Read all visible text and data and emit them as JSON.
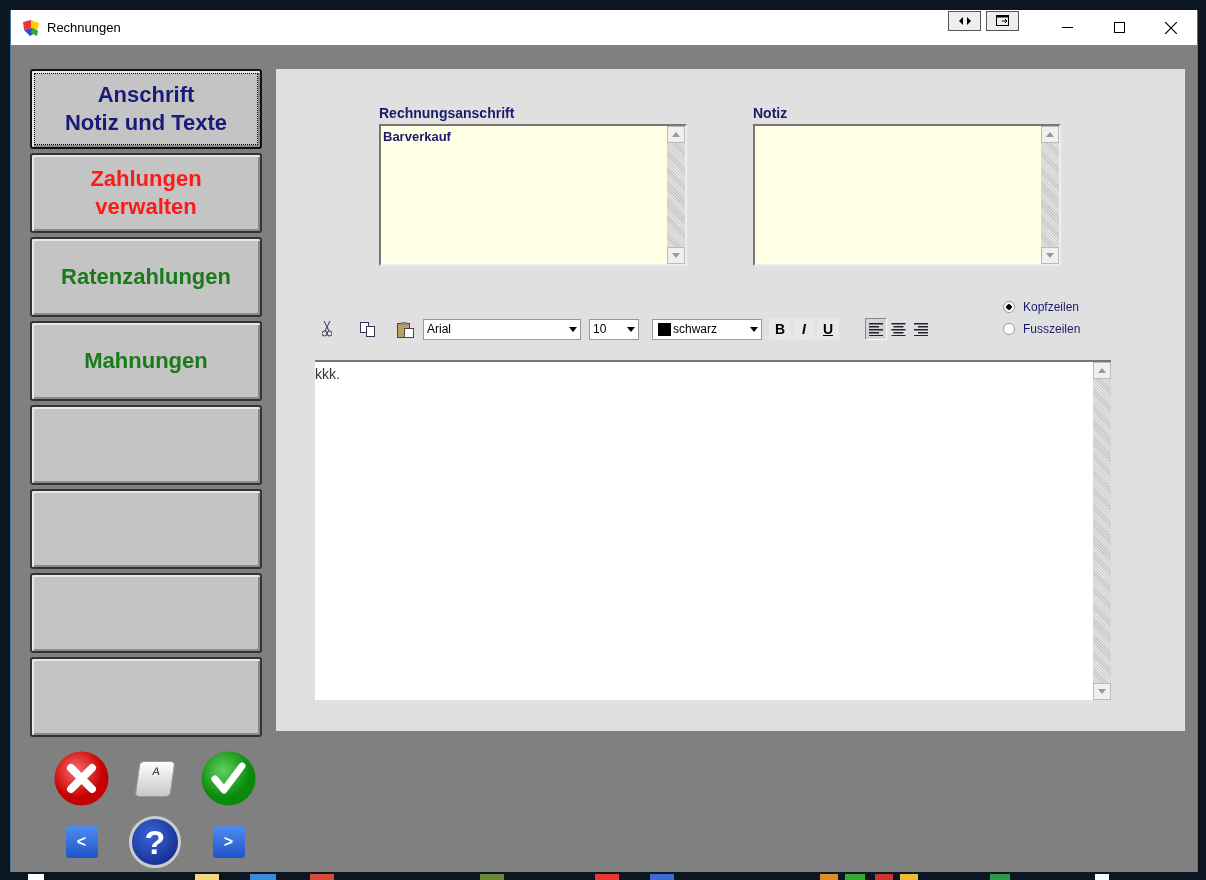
{
  "window": {
    "title": "Rechnungen"
  },
  "nav_buttons": [
    {
      "kind": "text",
      "label": "Anschrift\nNotiz und Texte",
      "color": "#1a1a7a",
      "selected": true
    },
    {
      "kind": "text",
      "label": "Zahlungen\nverwalten",
      "color": "#ff1a1a",
      "selected": false
    },
    {
      "kind": "text",
      "label": "Ratenzahlungen",
      "color": "#1a7a1a",
      "selected": false
    },
    {
      "kind": "text",
      "label": "Mahnungen",
      "color": "#1a7a1a",
      "selected": false
    },
    {
      "kind": "empty",
      "selected": false
    },
    {
      "kind": "empty",
      "selected": false
    },
    {
      "kind": "empty",
      "selected": false
    },
    {
      "kind": "empty",
      "selected": false
    }
  ],
  "address": {
    "label": "Rechnungsanschrift",
    "value": "Barverkauf"
  },
  "note": {
    "label": "Notiz"
  },
  "toolbar": {
    "font": "Arial",
    "size": "10",
    "color": {
      "name": "schwarz"
    },
    "bold": "B",
    "italic": "I",
    "underline": "U",
    "align": [
      {
        "kind": "left",
        "selected": true
      },
      {
        "kind": "center",
        "selected": false
      },
      {
        "kind": "right",
        "selected": false
      }
    ]
  },
  "section_radios": [
    {
      "label": "Kopfzeilen",
      "selected": true
    },
    {
      "label": "Fusszeilen",
      "selected": false
    }
  ],
  "editor": {
    "value": "kkk."
  },
  "bottom": {
    "keyboard_key": "A",
    "help": "?",
    "prev": "<",
    "next": ">"
  }
}
